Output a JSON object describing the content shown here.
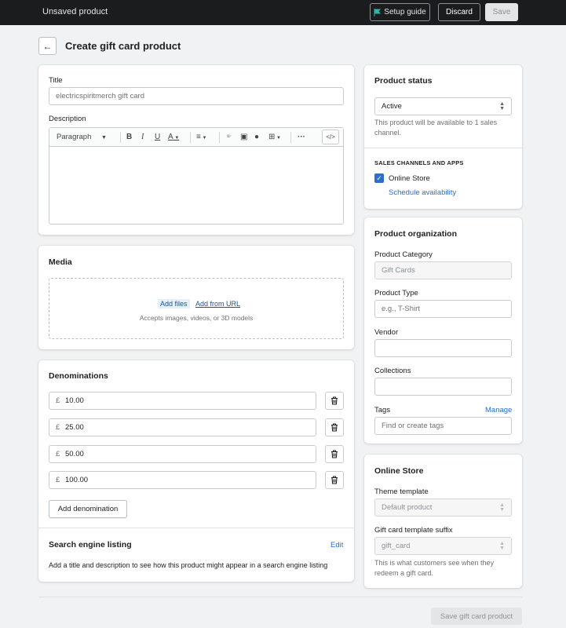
{
  "topbar": {
    "title": "Unsaved product",
    "setup_guide": "Setup guide",
    "discard": "Discard",
    "save": "Save"
  },
  "page": {
    "title": "Create gift card product"
  },
  "title_field": {
    "label": "Title",
    "value": "electricspiritmerch gift card"
  },
  "description": {
    "label": "Description",
    "paragraph": "Paragraph"
  },
  "media": {
    "heading": "Media",
    "add_files": "Add files",
    "add_from_url": "Add from URL",
    "accepts": "Accepts images, videos, or 3D models"
  },
  "denominations": {
    "heading": "Denominations",
    "currency": "£",
    "items": [
      "10.00",
      "25.00",
      "50.00",
      "100.00"
    ],
    "add_button": "Add denomination"
  },
  "seo": {
    "heading": "Search engine listing",
    "edit": "Edit",
    "text": "Add a title and description to see how this product might appear in a search engine listing"
  },
  "status": {
    "heading": "Product status",
    "value": "Active",
    "help": "This product will be available to 1 sales channel."
  },
  "channels": {
    "heading": "SALES CHANNELS AND APPS",
    "online_store": "Online Store",
    "schedule": "Schedule availability",
    "checked": true
  },
  "organization": {
    "heading": "Product organization",
    "category_label": "Product Category",
    "category_value": "Gift Cards",
    "type_label": "Product Type",
    "type_placeholder": "e.g., T-Shirt",
    "vendor_label": "Vendor",
    "collections_label": "Collections",
    "tags_label": "Tags",
    "manage": "Manage",
    "tags_placeholder": "Find or create tags"
  },
  "online_store": {
    "heading": "Online Store",
    "theme_label": "Theme template",
    "theme_value": "Default product",
    "suffix_label": "Gift card template suffix",
    "suffix_value": "gift_card",
    "suffix_help": "This is what customers see when they redeem a gift card."
  },
  "footer": {
    "save_button": "Save gift card product"
  },
  "colors": {
    "accent": "#2c6ecb",
    "topbar": "#1a1c1d",
    "background": "#f1f2f3"
  }
}
